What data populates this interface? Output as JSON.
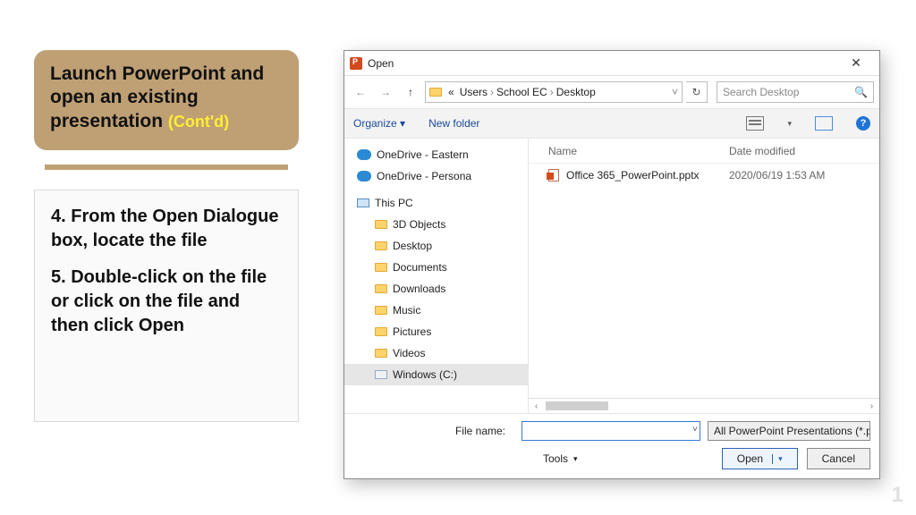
{
  "slide": {
    "badge_title": "Launch PowerPoint and open an existing presentation ",
    "badge_contd": "(Cont'd)",
    "step4": "4. From the Open Dialogue box, locate the file",
    "step5": "5. Double-click on the file or click on the file and then click Open",
    "page_number": "1"
  },
  "dialog": {
    "title": "Open",
    "breadcrumb": {
      "pre": "«",
      "seg1": "Users",
      "seg2": "School EC",
      "seg3": "Desktop"
    },
    "search_placeholder": "Search Desktop",
    "toolbar": {
      "organize": "Organize",
      "newfolder": "New folder"
    },
    "tree": {
      "onedrive_eastern": "OneDrive - Eastern",
      "onedrive_personal": "OneDrive - Persona",
      "this_pc": "This PC",
      "objects3d": "3D Objects",
      "desktop": "Desktop",
      "documents": "Documents",
      "downloads": "Downloads",
      "music": "Music",
      "pictures": "Pictures",
      "videos": "Videos",
      "cdrive": "Windows (C:)"
    },
    "columns": {
      "name": "Name",
      "date": "Date modified"
    },
    "file": {
      "name": "Office 365_PowerPoint.pptx",
      "date": "2020/06/19 1:53 AM"
    },
    "footer": {
      "filename_label": "File name:",
      "filename_value": "",
      "filter": "All PowerPoint Presentations (*.p",
      "tools": "Tools",
      "open": "Open",
      "cancel": "Cancel"
    }
  }
}
